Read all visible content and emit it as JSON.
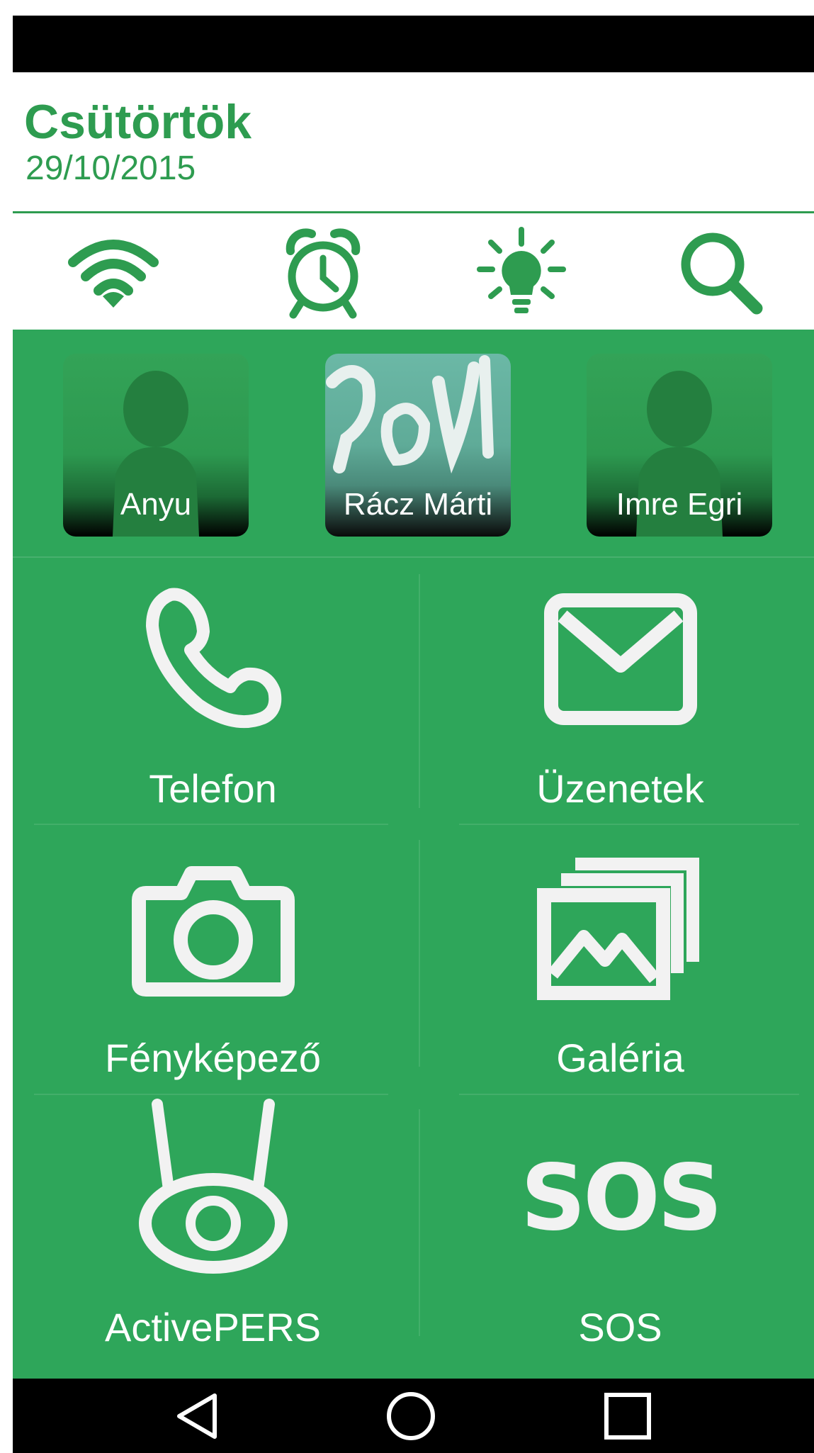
{
  "colors": {
    "accent": "#2e9c50",
    "green": "#2ea65a",
    "icon_light": "#f2f2f2"
  },
  "header": {
    "day": "Csütörtök",
    "date": "29/10/2015"
  },
  "quick_actions": [
    {
      "icon": "wifi-icon"
    },
    {
      "icon": "alarm-clock-icon"
    },
    {
      "icon": "flashlight-icon"
    },
    {
      "icon": "search-icon"
    }
  ],
  "favorites": [
    {
      "name": "Anyu",
      "avatar": "person-silhouette"
    },
    {
      "name": "Rácz Márti",
      "avatar": "photo"
    },
    {
      "name": "Imre Egri",
      "avatar": "person-silhouette"
    }
  ],
  "apps": {
    "phone": {
      "label": "Telefon",
      "icon": "phone-icon"
    },
    "messages": {
      "label": "Üzenetek",
      "icon": "envelope-icon"
    },
    "camera": {
      "label": "Fényképező",
      "icon": "camera-icon"
    },
    "gallery": {
      "label": "Galéria",
      "icon": "gallery-icon"
    },
    "activepers": {
      "label": "ActivePERS",
      "icon": "activepers-icon"
    },
    "sos": {
      "label": "SOS",
      "icon": "sos-icon",
      "icon_text": "SOS"
    }
  },
  "nav": [
    {
      "icon": "back-icon"
    },
    {
      "icon": "home-icon"
    },
    {
      "icon": "recents-icon"
    }
  ]
}
